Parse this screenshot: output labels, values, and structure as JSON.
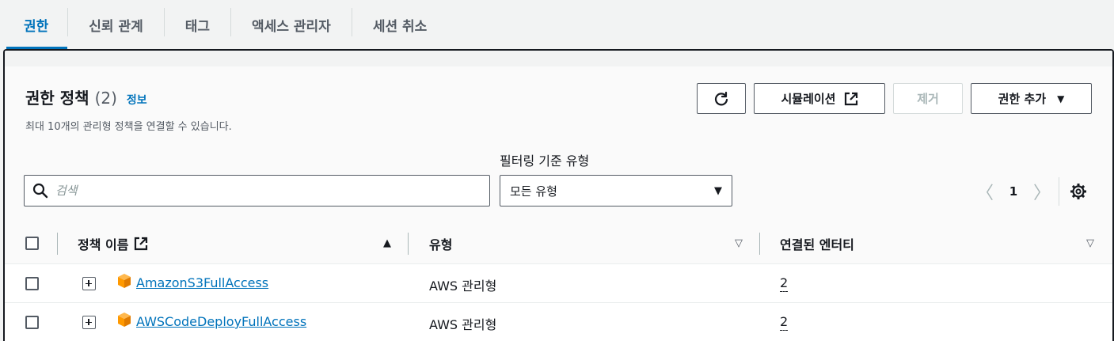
{
  "tabs": [
    {
      "label": "권한",
      "active": true
    },
    {
      "label": "신뢰 관계"
    },
    {
      "label": "태그"
    },
    {
      "label": "액세스 관리자"
    },
    {
      "label": "세션 취소"
    }
  ],
  "panel": {
    "title": "권한 정책",
    "count": "(2)",
    "info_link": "정보",
    "description": "최대 10개의 관리형 정책을 연결할 수 있습니다.",
    "buttons": {
      "refresh_icon": "refresh-icon",
      "simulation": "시뮬레이션",
      "remove": "제거",
      "add_permissions": "권한 추가"
    },
    "filter_label": "필터링 기준 유형",
    "search_placeholder": "검색",
    "type_select_value": "모든 유형",
    "page_number": "1"
  },
  "table": {
    "columns": [
      "정책 이름",
      "유형",
      "연결된 엔터티"
    ],
    "rows": [
      {
        "name": "AmazonS3FullAccess",
        "type": "AWS 관리형",
        "entities": "2"
      },
      {
        "name": "AWSCodeDeployFullAccess",
        "type": "AWS 관리형",
        "entities": "2"
      }
    ]
  },
  "colors": {
    "accent": "#0073bb",
    "text": "#16191f",
    "muted": "#545b64",
    "disabled": "#aab7b8",
    "aws_cube": "#ff9900"
  }
}
